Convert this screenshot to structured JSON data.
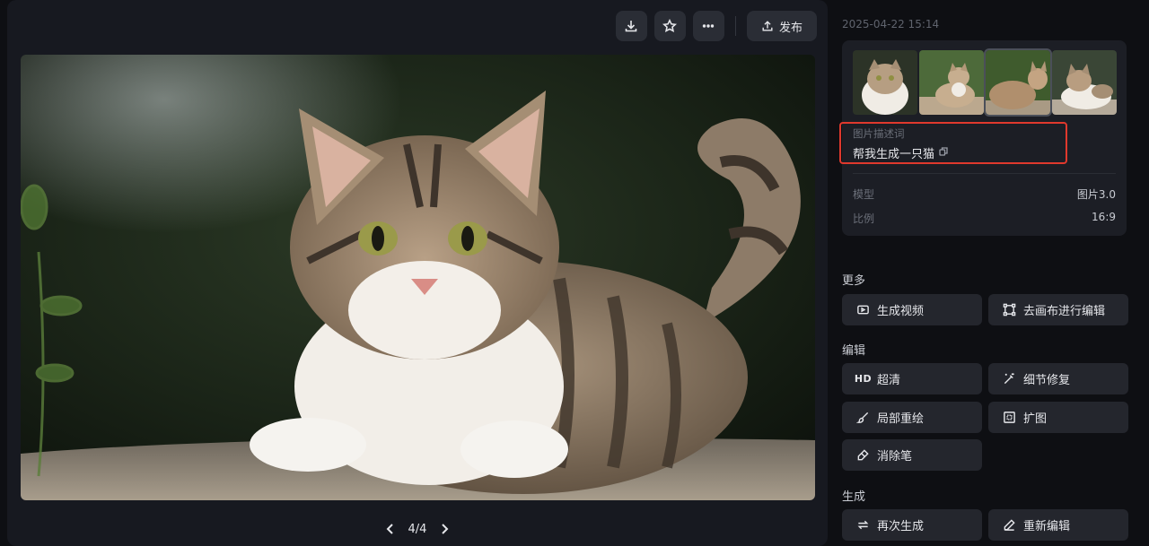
{
  "toolbar": {
    "download_icon": "download-icon",
    "favorite_icon": "star-icon",
    "more_icon": "more-icon",
    "publish_label": "发布"
  },
  "viewer": {
    "pager": "4/4"
  },
  "detail": {
    "timestamp": "2025-04-22 15:14",
    "prompt_label": "图片描述词",
    "prompt_text": "帮我生成一只猫",
    "model_key": "模型",
    "model_value": "图片3.0",
    "ratio_key": "比例",
    "ratio_value": "16:9"
  },
  "sections": {
    "more": {
      "title": "更多",
      "generate_video": "生成视频",
      "canvas_edit": "去画布进行编辑"
    },
    "edit": {
      "title": "编辑",
      "hd_icon_text": "HD",
      "hd": "超清",
      "detail_fix": "细节修复",
      "inpaint": "局部重绘",
      "expand": "扩图",
      "eraser": "消除笔"
    },
    "generate": {
      "title": "生成",
      "regenerate": "再次生成",
      "reedit": "重新编辑"
    }
  },
  "colors": {
    "background": "#0e0f13",
    "panel": "#171920",
    "button": "#2a2d35",
    "highlight_box": "#e0392d"
  }
}
